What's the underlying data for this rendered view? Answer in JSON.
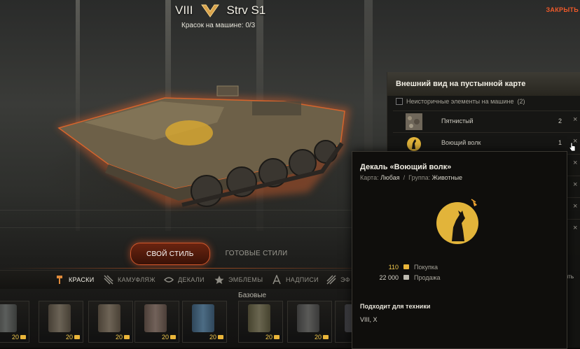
{
  "header": {
    "tier": "VIII",
    "vehicle_name": "Strv S1",
    "paint_status": "Красок на машине: 0/3",
    "close_label": "ЗАКРЫТЬ"
  },
  "style_tabs": [
    {
      "label": "СВОЙ СТИЛЬ",
      "active": true
    },
    {
      "label": "ГОТОВЫЕ СТИЛИ",
      "active": false
    }
  ],
  "categories": [
    {
      "label": "КРАСКИ",
      "icon": "paint-roller-icon",
      "active": true
    },
    {
      "label": "КАМУФЛЯЖ",
      "icon": "camouflage-icon",
      "active": false
    },
    {
      "label": "ДЕКАЛИ",
      "icon": "decal-icon",
      "active": false
    },
    {
      "label": "ЭМБЛЕМЫ",
      "icon": "star-emblem-icon",
      "active": false
    },
    {
      "label": "НАДПИСИ",
      "icon": "inscription-icon",
      "active": false
    },
    {
      "label": "ЭФ",
      "icon": "effects-icon",
      "active": false
    }
  ],
  "group_title": "Базовые",
  "paints": [
    {
      "price": "20",
      "color": "#5b5e5c"
    },
    {
      "price": "20",
      "color": "#6b6356"
    },
    {
      "price": "20",
      "color": "#6e6456"
    },
    {
      "price": "20",
      "color": "#72625a"
    },
    {
      "price": "20",
      "color": "#4c6c84"
    },
    {
      "price": "20",
      "color": "#6a6650"
    },
    {
      "price": "20",
      "color": "#5a5a58"
    },
    {
      "price": "20",
      "color": "#56565a"
    }
  ],
  "panel": {
    "title": "Внешний вид на пустынной карте",
    "nonhistorical_label": "Неисторичные элементы на машине",
    "nonhistorical_count": "(2)",
    "items": [
      {
        "name": "Пятнистый",
        "count": "2",
        "icon": "spotted-camo-icon"
      },
      {
        "name": "Воющий волк",
        "count": "1",
        "icon": "howling-wolf-icon"
      }
    ],
    "footer_partial": "ить"
  },
  "tooltip": {
    "title": "Декаль «Воющий волк»",
    "map_label": "Карта:",
    "map_value": "Любая",
    "group_label": "Группа:",
    "group_value": "Животные",
    "buy_price": "110",
    "buy_label": "Покупка",
    "sell_price": "22 000",
    "sell_label": "Продажа",
    "fits_title": "Подходит для техники",
    "fits_value": "VIII, X"
  },
  "colors": {
    "accent": "#f05a2a",
    "gold": "#f2c94c",
    "decal_yellow": "#e2b43a"
  }
}
